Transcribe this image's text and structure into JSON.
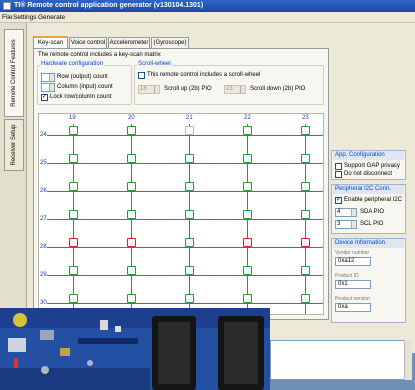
{
  "window": {
    "title": "TI® Remote control application generator (v130104.1301)"
  },
  "menu": [
    "File",
    "Settings",
    "Generate"
  ],
  "side_tabs": [
    "Remote Control Features",
    "Receiver Setup"
  ],
  "tabs": [
    "Key-scan",
    "Voice control",
    "Accelerometer",
    "(Gyroscope)"
  ],
  "keyscan": {
    "desc": "The remote control includes a key-scan matrix",
    "hw_title": "Hardware configuration",
    "row_count_label": "Row (output) count",
    "col_count_label": "Column (input) count",
    "lock_label": "Lock row/column count",
    "scroll_title": "Scroll-wheel",
    "scroll_desc": "This remote control includes a scroll-wheel",
    "scroll_up_value": "16",
    "scroll_up_label": "Scroll up (2b) PIO",
    "scroll_down_value": "23",
    "scroll_down_label": "Scroll down (2b) PIO"
  },
  "matrix": {
    "columns": [
      "19",
      "20",
      "21",
      "22",
      "23"
    ],
    "rows": [
      "24",
      "25",
      "26",
      "27",
      "28",
      "29",
      "30"
    ],
    "key_states": [
      [
        "green",
        "green",
        "light",
        "green",
        "green"
      ],
      [
        "green",
        "green",
        "green",
        "green",
        "green"
      ],
      [
        "green",
        "green",
        "green",
        "green",
        "green"
      ],
      [
        "green",
        "green",
        "green",
        "green",
        "green"
      ],
      [
        "red",
        "red",
        "green",
        "red",
        "red"
      ],
      [
        "green",
        "green",
        "green",
        "green",
        "green"
      ],
      [
        "green",
        "green",
        "green",
        "green",
        "green"
      ]
    ]
  },
  "app_config": {
    "title": "App. Configuration",
    "gap_privacy": "Support GAP privacy",
    "no_disconnect": "Do not disconnect"
  },
  "i2c": {
    "title": "Peripheral I2C Conn.",
    "enable": "Enable peripheral I2C",
    "sda_value": "4",
    "sda_label": "SDA PIO",
    "scl_value": "3",
    "scl_label": "SCL PIO"
  },
  "device_info": {
    "title": "Device Information",
    "f1_label": "Vendor number",
    "f1_value": "0xa12",
    "f2_label": "Product ID",
    "f2_value": "0x1",
    "f3_label": "Product version",
    "f3_value": "0xa"
  },
  "colors": {
    "title_bar": "#2d64c8",
    "key_ok": "#2c9a2c",
    "key_conflict": "#e02020",
    "accent": "#0046d5"
  }
}
